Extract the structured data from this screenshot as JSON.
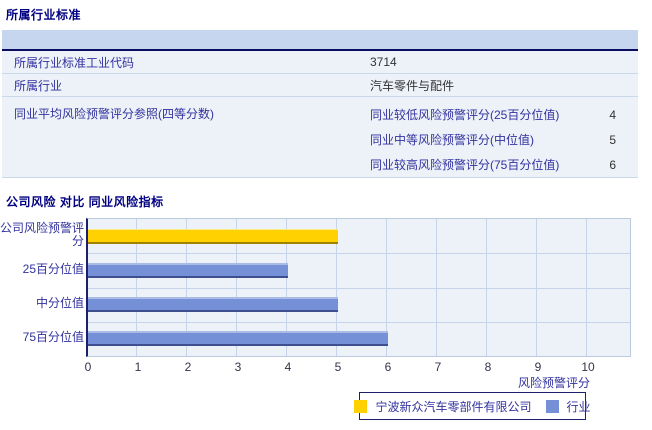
{
  "section1": {
    "title": "所属行业标准",
    "table": {
      "rows": [
        {
          "label": "所属行业标准工业代码",
          "value": "3714"
        },
        {
          "label": "所属行业",
          "value": "汽车零件与配件"
        }
      ],
      "quartile": {
        "label": "同业平均风险预警评分参照(四等分数)",
        "items": [
          {
            "label": "同业较低风险预警评分(25百分位值)",
            "value": "4"
          },
          {
            "label": "同业中等风险预警评分(中位值)",
            "value": "5"
          },
          {
            "label": "同业较高风险预警评分(75百分位值)",
            "value": "6"
          }
        ]
      }
    }
  },
  "section2": {
    "title": "公司风险 对比 同业风险指标"
  },
  "chart_data": {
    "type": "bar",
    "orientation": "horizontal",
    "categories": [
      "公司风险预警评分",
      "25百分位值",
      "中分位值",
      "75百分位值"
    ],
    "values": [
      5,
      4,
      5,
      6
    ],
    "bar_series": [
      "company",
      "industry",
      "industry",
      "industry"
    ],
    "xlabel": "风险预警评分",
    "xlim": [
      0,
      10
    ],
    "xticks": [
      0,
      1,
      2,
      3,
      4,
      5,
      6,
      7,
      8,
      9,
      10
    ],
    "grid": true,
    "legend_position": "bottom",
    "legend": [
      {
        "label": "宁波新众汽车零部件有限公司",
        "series": "company",
        "color": "#FFD100"
      },
      {
        "label": "行业",
        "series": "industry",
        "color": "#7590D6"
      }
    ],
    "colors": {
      "company_bar": "#FFD100",
      "industry_bar": "#7590D6",
      "plot_background": "#EDF1F8",
      "gridline": "#C7D3E8",
      "axis": "#1E1E6E",
      "header_band": "#C6D6EE",
      "label_text": "#32329E",
      "title_text": "#000080"
    }
  }
}
